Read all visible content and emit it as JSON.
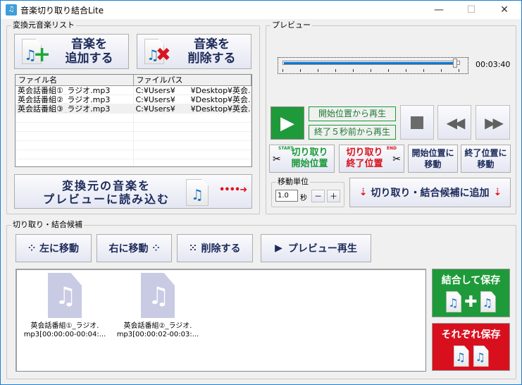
{
  "window": {
    "title": "音楽切り取り結合Lite",
    "minimize": "—",
    "maximize": "☐",
    "close": "✕"
  },
  "source_list": {
    "group_label": "変換元音楽リスト",
    "add_button": {
      "line1": "音楽を",
      "line2": "追加する"
    },
    "remove_button": {
      "line1": "音楽を",
      "line2": "削除する"
    },
    "columns": [
      "ファイル名",
      "ファイルパス"
    ],
    "rows": [
      {
        "name": "英会話番組①_ラジオ.mp3",
        "path": "C:¥Users¥　　¥Desktop¥英会..."
      },
      {
        "name": "英会話番組②_ラジオ.mp3",
        "path": "C:¥Users¥　　¥Desktop¥英会..."
      },
      {
        "name": "英会話番組③_ラジオ.mp3",
        "path": "C:¥Users¥　　¥Desktop¥英会..."
      }
    ],
    "load_button": {
      "line1": "変換元の音楽を",
      "line2": "プレビューに読み込む"
    }
  },
  "preview": {
    "group_label": "プレビュー",
    "time": "00:03:40",
    "progress": 0.98,
    "play_from_start": "開始位置から再生",
    "play_last5": "終了５秒前から再生",
    "cut_start": {
      "line1": "切り取り",
      "line2": "開始位置",
      "tag": "START"
    },
    "cut_end": {
      "line1": "切り取り",
      "line2": "終了位置",
      "tag": "END"
    },
    "goto_start": {
      "line1": "開始位置に",
      "line2": "移動"
    },
    "goto_end": {
      "line1": "終了位置に",
      "line2": "移動"
    },
    "step_label": "移動単位",
    "step_value": "1.0",
    "step_unit": "秒",
    "minus": "－",
    "plus": "＋",
    "add_candidate": "切り取り・結合候補に追加"
  },
  "candidates": {
    "group_label": "切り取り・結合候補",
    "move_left": "左に移動",
    "move_right": "右に移動",
    "delete": "削除する",
    "preview_play": "プレビュー再生",
    "items": [
      {
        "line1": "英会話番組①_ラジオ.",
        "line2": "mp3[00:00:00-00:04:..."
      },
      {
        "line1": "英会話番組②_ラジオ.",
        "line2": "mp3[00:00:02-00:03:..."
      }
    ],
    "merge_save": "結合して保存",
    "separate_save": "それぞれ保存"
  }
}
